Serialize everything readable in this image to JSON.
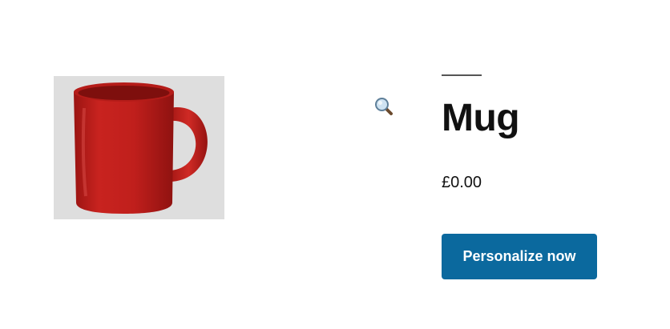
{
  "product": {
    "title": "Mug",
    "price": "£0.00",
    "image_icon": "red-mug",
    "zoom_icon": "magnifier-icon"
  },
  "actions": {
    "personalize_label": "Personalize now"
  },
  "colors": {
    "button_bg": "#0b699e",
    "button_text": "#ffffff",
    "title_text": "#111111",
    "image_bg": "#dedede",
    "mug_red": "#c0201e"
  }
}
